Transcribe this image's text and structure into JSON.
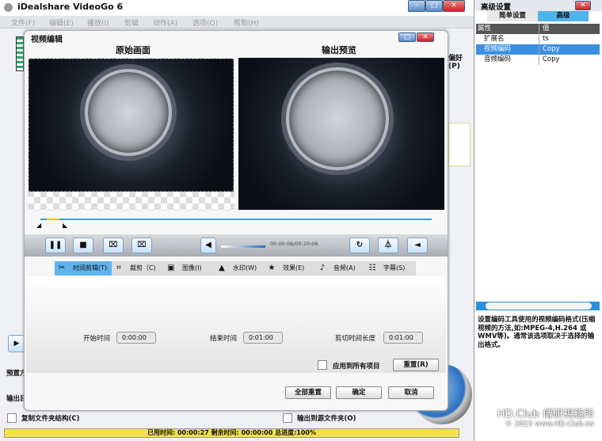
{
  "app": {
    "title": "iDealshare VideoGo 6"
  },
  "menu": [
    "文件(F)",
    "编辑(E)",
    "播放(I)",
    "剪辑",
    "动作(A)",
    "选项(O)",
    "帮助(H)"
  ],
  "background": {
    "pref_label": "偏好(P)",
    "preset_label": "预置方",
    "output_label": "输出目",
    "copy_folder": "复制文件夹结构(C)",
    "output_source": "输出到源文件夹(O)",
    "status": "已用时间: 00:00:27 剩余时间: 00:00:00 总进度:100%",
    "progress_percent": 100
  },
  "dialog": {
    "title": "视频编辑",
    "original_label": "原始画面",
    "preview_label": "输出预览",
    "time_display": "00:00:06/00:20:06",
    "tabs": [
      "时间剪辑(T)",
      "裁剪（C)",
      "图像(I)",
      "水印(W)",
      "效果(E)",
      "音频(A)",
      "字幕(S)"
    ],
    "start_label": "开始时间",
    "start_value": "0:00:00",
    "end_label": "结束时间",
    "end_value": "0:01:00",
    "length_label": "剪切时间长度",
    "length_value": "0:01:00",
    "apply_all": "应用到所有项目",
    "reset": "重置(R)",
    "reset_all": "全部重置",
    "ok": "确定",
    "cancel": "取消"
  },
  "panel": {
    "title": "高级设置",
    "tab_simple": "简单设置",
    "tab_advanced": "高级",
    "col_prop": "属性",
    "col_value": "值",
    "rows": [
      {
        "prop": "扩展名",
        "value": "ts"
      },
      {
        "prop": "视频编码",
        "value": "Copy"
      },
      {
        "prop": "音频编码",
        "value": "Copy"
      }
    ],
    "description": "设置编码工具使用的视频编码格式(压缩视频的方法,如:MPEG-4,H.264 或 WMV等)。通常该选项取决于选择的输出格式。"
  },
  "watermark": {
    "line1": "HD.Club 傳研視務所",
    "line2": "© 2015 www.HD.Club.tw"
  },
  "colors": {
    "accent": "#5fb3ee",
    "selected": "#3b8fe0",
    "progress": "#f3e04a"
  }
}
